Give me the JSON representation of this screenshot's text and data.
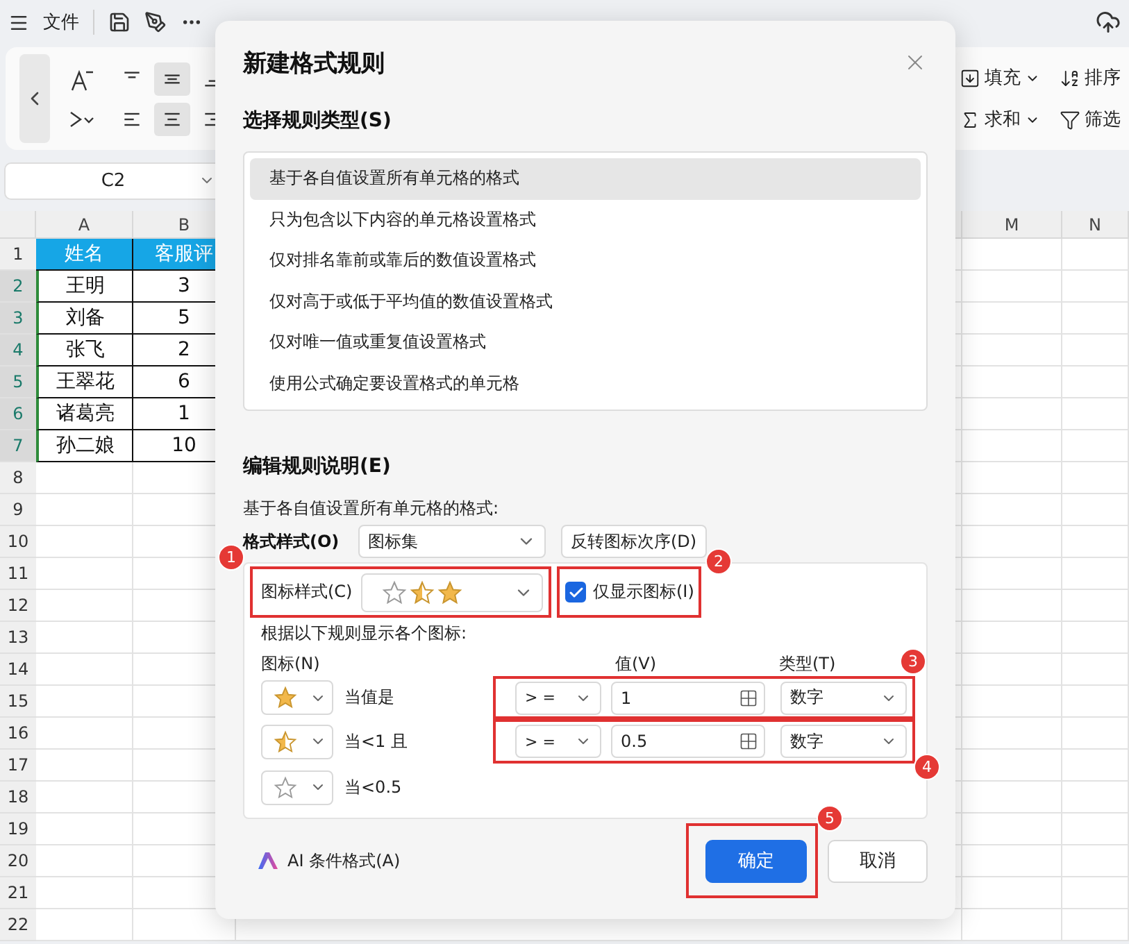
{
  "top_bar": {
    "file_menu": "文件"
  },
  "ribbon": {
    "align_buttons": [
      {
        "kind": "top",
        "selected": false
      },
      {
        "kind": "middle",
        "selected": true
      },
      {
        "kind": "bottom",
        "selected": false
      },
      {
        "kind": "left",
        "selected": false
      },
      {
        "kind": "center",
        "selected": true
      },
      {
        "kind": "right",
        "selected": false
      }
    ],
    "tools": [
      {
        "kind": "fill",
        "label": "填充",
        "has_menu": true
      },
      {
        "kind": "sort",
        "label": "排序",
        "has_menu": false
      },
      {
        "kind": "sum",
        "label": "求和",
        "has_menu": true
      },
      {
        "kind": "filter",
        "label": "筛选",
        "has_menu": false
      }
    ]
  },
  "name_box": {
    "value": "C2"
  },
  "sheet": {
    "columns": [
      {
        "label": "A"
      },
      {
        "label": "B"
      },
      {
        "label": "M"
      },
      {
        "label": "N"
      }
    ],
    "rows": [
      {
        "number": "1",
        "kind": "header",
        "selected": false,
        "cells": [
          "姓名",
          "客服评"
        ]
      },
      {
        "number": "2",
        "kind": "data",
        "selected": true,
        "cells": [
          "王明",
          "3"
        ]
      },
      {
        "number": "3",
        "kind": "data",
        "selected": true,
        "cells": [
          "刘备",
          "5"
        ]
      },
      {
        "number": "4",
        "kind": "data",
        "selected": true,
        "cells": [
          "张飞",
          "2"
        ]
      },
      {
        "number": "5",
        "kind": "data",
        "selected": true,
        "cells": [
          "王翠花",
          "6"
        ]
      },
      {
        "number": "6",
        "kind": "data",
        "selected": true,
        "cells": [
          "诸葛亮",
          "1"
        ]
      },
      {
        "number": "7",
        "kind": "data",
        "selected": true,
        "cells": [
          "孙二娘",
          "10"
        ]
      },
      {
        "number": "8",
        "selected": false
      },
      {
        "number": "9",
        "selected": false
      },
      {
        "number": "10",
        "selected": false
      },
      {
        "number": "11",
        "selected": false
      },
      {
        "number": "12",
        "selected": false
      },
      {
        "number": "13",
        "selected": false
      },
      {
        "number": "14",
        "selected": false
      },
      {
        "number": "15",
        "selected": false
      },
      {
        "number": "16",
        "selected": false
      },
      {
        "number": "17",
        "selected": false
      },
      {
        "number": "18",
        "selected": false
      },
      {
        "number": "19",
        "selected": false
      },
      {
        "number": "20",
        "selected": false
      },
      {
        "number": "21",
        "selected": false
      },
      {
        "number": "22",
        "selected": false
      }
    ]
  },
  "dialog": {
    "title": "新建格式规则",
    "rule_type_heading": "选择规则类型(S)",
    "rule_types": [
      {
        "label": "基于各自值设置所有单元格的格式",
        "selected": true
      },
      {
        "label": "只为包含以下内容的单元格设置格式",
        "selected": false
      },
      {
        "label": "仅对排名靠前或靠后的数值设置格式",
        "selected": false
      },
      {
        "label": "仅对高于或低于平均值的数值设置格式",
        "selected": false
      },
      {
        "label": "仅对唯一值或重复值设置格式",
        "selected": false
      },
      {
        "label": "使用公式确定要设置格式的单元格",
        "selected": false
      }
    ],
    "edit_heading": "编辑规则说明(E)",
    "description": "基于各自值设置所有单元格的格式:",
    "format_style": {
      "label": "格式样式(O)",
      "value": "图标集"
    },
    "reverse_button": "反转图标次序(D)",
    "icon_style": {
      "label": "图标样式(C)",
      "callout": "1"
    },
    "icon_only": {
      "label": "仅显示图标(I)",
      "checked": true,
      "callout": "2"
    },
    "rules_caption": "根据以下规则显示各个图标:",
    "headers": {
      "icon": "图标(N)",
      "value": "值(V)",
      "type": "类型(T)"
    },
    "icon_rules": [
      {
        "condition": "当值是",
        "operator": "> =",
        "value": "1",
        "type": "数字",
        "callout": "3"
      },
      {
        "condition": "当<1 且",
        "operator": "> =",
        "value": "0.5",
        "type": "数字",
        "callout": "4"
      },
      {
        "condition": "当<0.5"
      }
    ],
    "ai_button": "AI 条件格式(A)",
    "ok_button": {
      "label": "确定",
      "callout": "5"
    },
    "cancel_button": "取消"
  }
}
